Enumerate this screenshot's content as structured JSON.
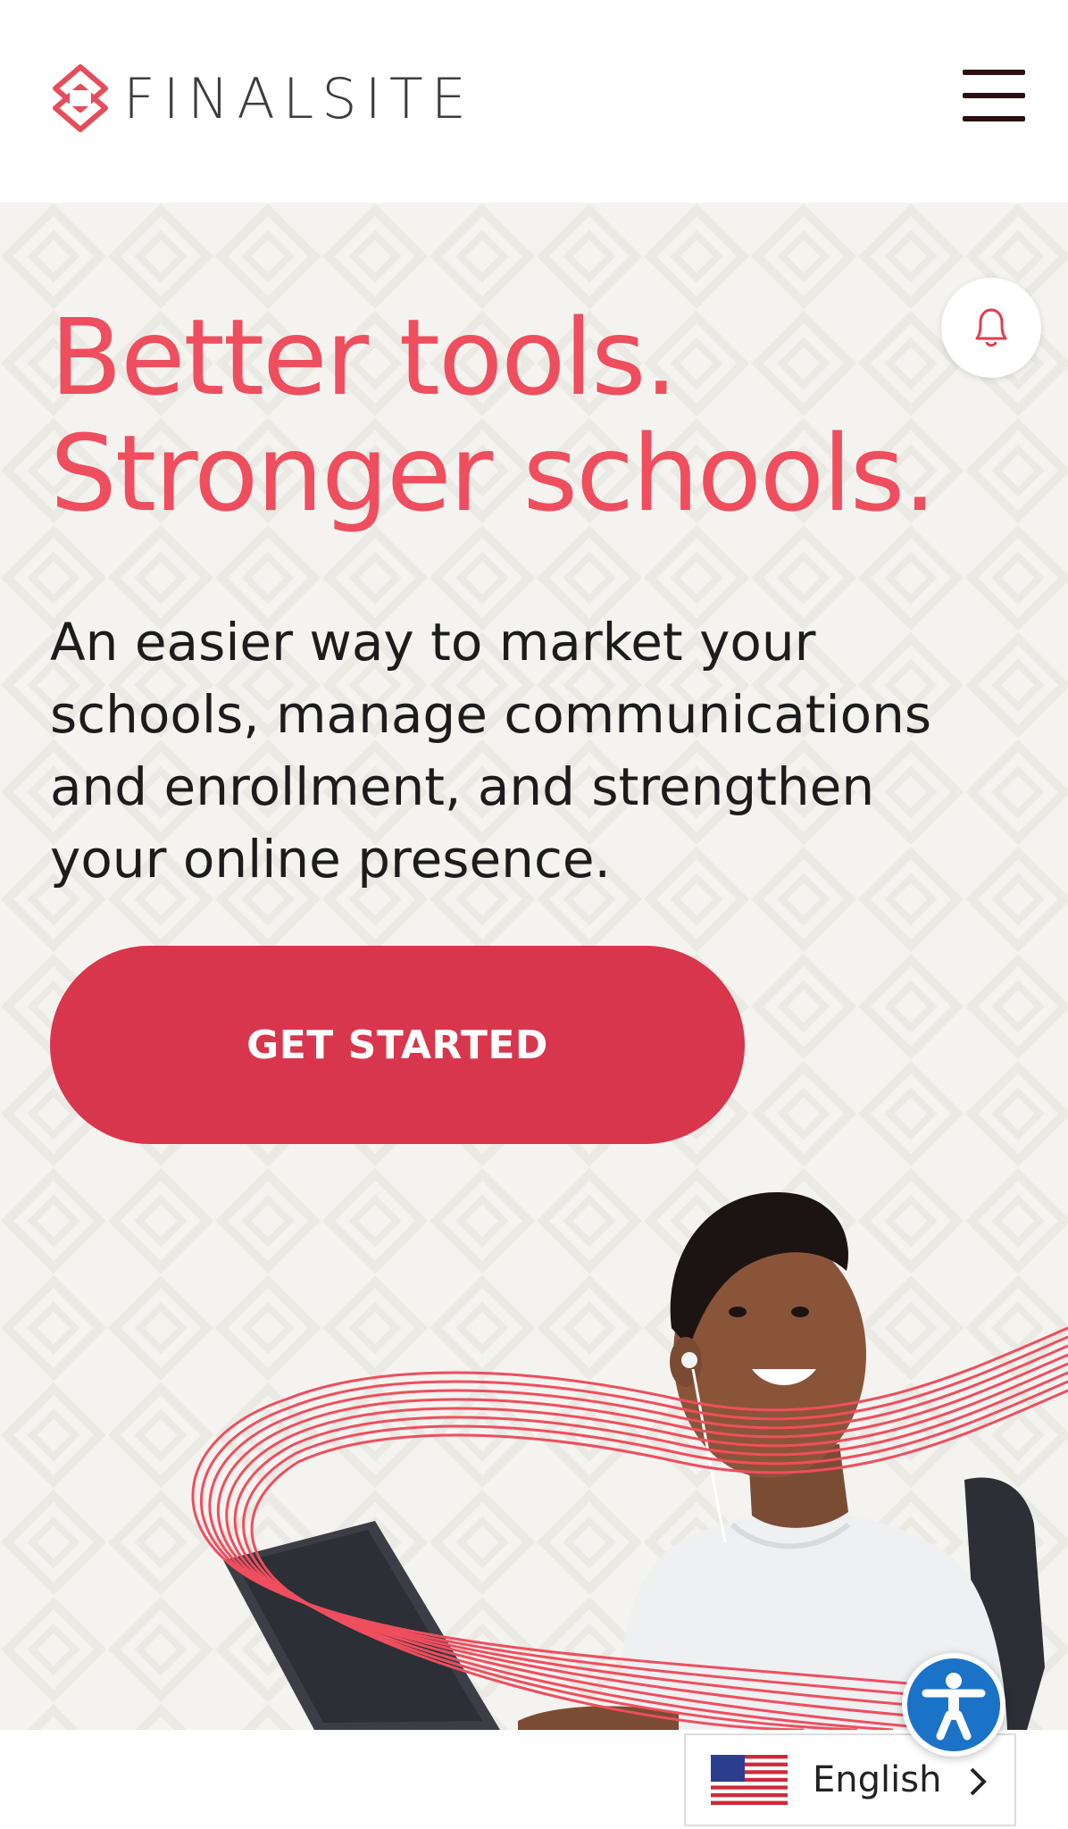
{
  "header": {
    "brand": "FINALSITE",
    "logo_icon": "finalsite-diamond-logo",
    "menu_icon": "hamburger-menu-icon"
  },
  "hero": {
    "headline_line1": "Better tools.",
    "headline_line2": "Stronger schools.",
    "subtext": "An easier way to market your schools, manage communications and enrollment, and strengthen your online presence.",
    "cta_label": "GET STARTED",
    "notification_icon": "bell-icon"
  },
  "widgets": {
    "accessibility_icon": "accessibility-person-icon",
    "language_label": "English",
    "language_flag": "us-flag-icon",
    "language_chevron": "chevron-right-icon"
  },
  "colors": {
    "accent": "#ee4e5e",
    "button": "#d8364d",
    "hero_bg": "#f4f3ef",
    "text_dark": "#1c1c1c",
    "accessibility_blue": "#1a73c6"
  }
}
